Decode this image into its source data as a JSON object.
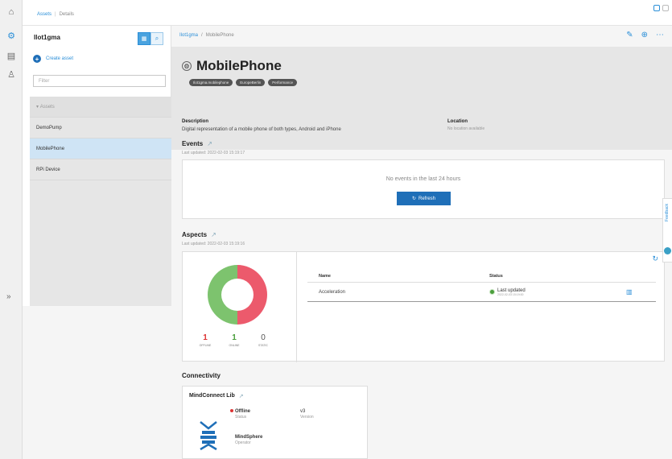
{
  "rail": {
    "icons": [
      "home-icon",
      "assets-icon",
      "monitor-icon",
      "user-icon"
    ],
    "expand": "»"
  },
  "topbar": {
    "crumb_1": "Assets",
    "crumb_sep": "|",
    "crumb_2": "Details"
  },
  "tree": {
    "title": "Ilot1gma",
    "create_label": "Create asset",
    "filter_placeholder": "Filter",
    "header": "Assets",
    "items": [
      {
        "label": "DemoPump"
      },
      {
        "label": "MobilePhone"
      },
      {
        "label": "RPi Device"
      }
    ]
  },
  "main": {
    "breadcrumb_root": "Ilot1gma",
    "breadcrumb_sep": "/",
    "breadcrumb_current": "MobilePhone",
    "title": "MobilePhone",
    "tags": [
      "Ilot1gma.mobilephone",
      "EuropeBerlin",
      "Performance"
    ],
    "description_label": "Description",
    "description": "Digital representation of a mobile phone of both types, Android and iPhone",
    "location_label": "Location",
    "location_value": "No location available"
  },
  "events": {
    "title": "Events",
    "updated": "Last updated: 2022-02-03 15:19:17",
    "empty_text": "No events in the last 24 hours",
    "refresh_label": "Refresh"
  },
  "aspects": {
    "title": "Aspects",
    "updated": "Last updated: 2022-02-03 15:19:16",
    "offline_count": "1",
    "offline_label": "OFFLINE",
    "online_count": "1",
    "online_label": "ONLINE",
    "static_count": "0",
    "static_label": "STATIC",
    "col_name": "Name",
    "col_status": "Status",
    "rows": [
      {
        "name": "Acceleration",
        "status": "Last updated",
        "time": "2022-02-03 15:19:00"
      }
    ]
  },
  "connectivity": {
    "title": "Connectivity",
    "card_title": "MindConnect Lib",
    "status_value": "Offline",
    "status_label": "Status",
    "version_value": "v3",
    "version_label": "Version",
    "operator_value": "MindSphere",
    "operator_label": "Operator"
  },
  "feedback": {
    "label": "Feedback"
  },
  "colors": {
    "accent": "#2b8fd8",
    "offline": "#ec5a6c",
    "online": "#7dc36e"
  }
}
